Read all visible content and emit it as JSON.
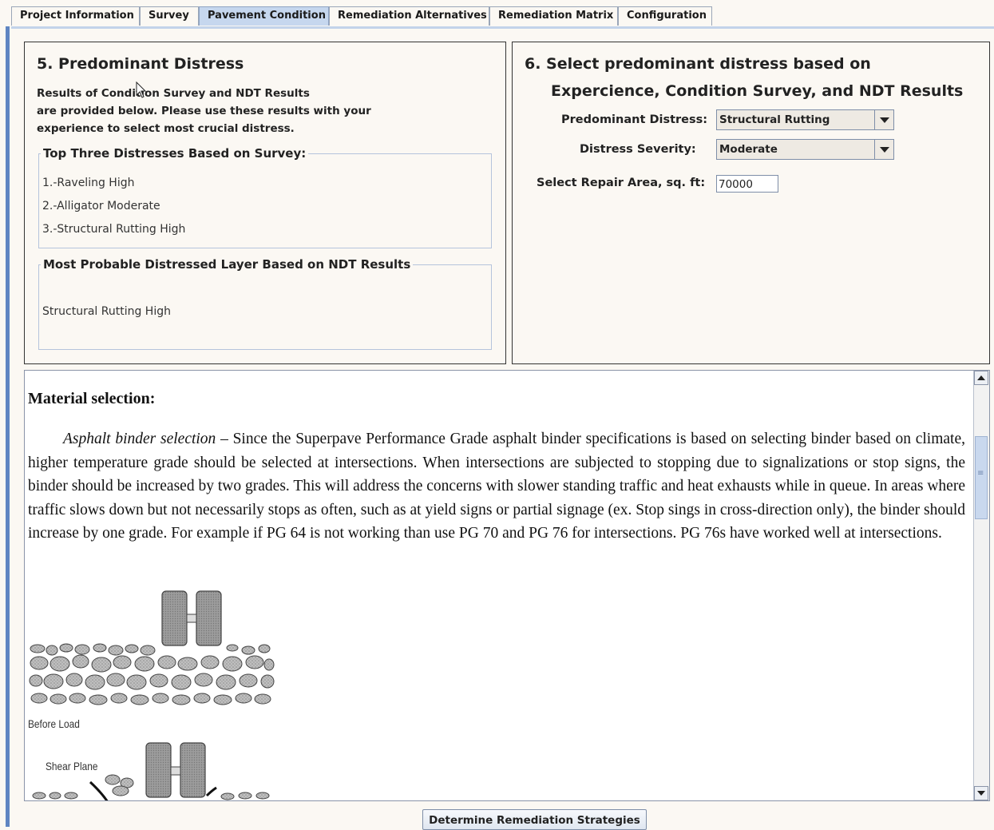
{
  "tabs": [
    {
      "label": "Project Information"
    },
    {
      "label": "Survey"
    },
    {
      "label": "Pavement Condition"
    },
    {
      "label": "Remediation Alternatives"
    },
    {
      "label": "Remediation Matrix"
    },
    {
      "label": "Configuration"
    }
  ],
  "active_tab": "Pavement Condition",
  "panel5": {
    "title": "5. Predominant Distress",
    "description": [
      "Results of Condition Survey and NDT Results",
      "are provided below. Please use these results with your",
      "experience to select most crucial distress."
    ],
    "survey_group": {
      "title": "Top Three Distresses Based on Survey:",
      "items": [
        "1.-Raveling High",
        "2.-Alligator Moderate",
        "3.-Structural Rutting High"
      ]
    },
    "ndt_group": {
      "title": "Most Probable Distressed Layer Based on NDT Results",
      "value": "Structural Rutting High"
    }
  },
  "panel6": {
    "title_line1": "6. Select predominant distress based on",
    "title_line2": "Expercience, Condition Survey, and NDT Results",
    "predominant_distress": {
      "label": "Predominant Distress:",
      "value": "Structural Rutting"
    },
    "distress_severity": {
      "label": "Distress Severity:",
      "value": "Moderate"
    },
    "repair_area": {
      "label": "Select Repair Area, sq. ft:",
      "value": "70000"
    }
  },
  "material": {
    "heading": "Material selection:",
    "lead_italic": "Asphalt binder selection",
    "paragraph": " – Since the Superpave Performance Grade asphalt binder specifications is based on selecting binder based on climate, higher temperature grade should be selected at intersections. When intersections are subjected to stopping due to signalizations or stop signs, the binder should be increased by two grades. This will address the concerns with slower standing traffic and heat exhausts while in queue. In areas where traffic slows down but not necessarily stops as often, such as at yield signs or partial signage (ex. Stop sings in cross-direction only), the binder should increase by one grade. For example if PG 64 is not working than use PG 70 and PG 76 for intersections.  PG 76s have worked well at intersections.",
    "figure_labels": {
      "before": "Before Load",
      "shear": "Shear Plane"
    }
  },
  "action_button": "Determine Remediation Strategies"
}
